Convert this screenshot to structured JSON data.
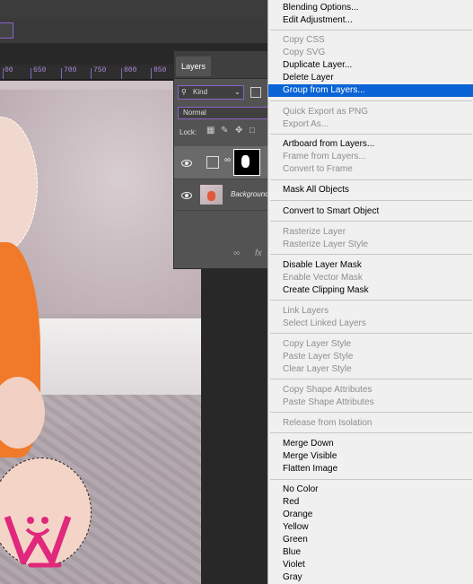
{
  "ruler": {
    "ticks": [
      "00",
      "650",
      "700",
      "750",
      "800",
      "850"
    ]
  },
  "layers_panel": {
    "tab_label": "Layers",
    "filter_kind": "Kind",
    "blend_mode": "Normal",
    "lock_label": "Lock:",
    "background_layer_name": "Background",
    "fx_label": "fx"
  },
  "context_menu": {
    "items": [
      {
        "label": "Blending Options...",
        "enabled": true
      },
      {
        "label": "Edit Adjustment...",
        "enabled": true
      },
      {
        "label": "Copy CSS",
        "enabled": false
      },
      {
        "label": "Copy SVG",
        "enabled": false
      },
      {
        "label": "Duplicate Layer...",
        "enabled": true
      },
      {
        "label": "Delete Layer",
        "enabled": true
      },
      {
        "label": "Group from Layers...",
        "enabled": true,
        "selected": true
      },
      {
        "label": "Quick Export as PNG",
        "enabled": false
      },
      {
        "label": "Export As...",
        "enabled": false
      },
      {
        "label": "Artboard from Layers...",
        "enabled": true
      },
      {
        "label": "Frame from Layers...",
        "enabled": false
      },
      {
        "label": "Convert to Frame",
        "enabled": false
      },
      {
        "label": "Mask All Objects",
        "enabled": true
      },
      {
        "label": "Convert to Smart Object",
        "enabled": true
      },
      {
        "label": "Rasterize Layer",
        "enabled": false
      },
      {
        "label": "Rasterize Layer Style",
        "enabled": false
      },
      {
        "label": "Disable Layer Mask",
        "enabled": true
      },
      {
        "label": "Enable Vector Mask",
        "enabled": false
      },
      {
        "label": "Create Clipping Mask",
        "enabled": true
      },
      {
        "label": "Link Layers",
        "enabled": false
      },
      {
        "label": "Select Linked Layers",
        "enabled": false
      },
      {
        "label": "Copy Layer Style",
        "enabled": false
      },
      {
        "label": "Paste Layer Style",
        "enabled": false
      },
      {
        "label": "Clear Layer Style",
        "enabled": false
      },
      {
        "label": "Copy Shape Attributes",
        "enabled": false
      },
      {
        "label": "Paste Shape Attributes",
        "enabled": false
      },
      {
        "label": "Release from Isolation",
        "enabled": false
      },
      {
        "label": "Merge Down",
        "enabled": true
      },
      {
        "label": "Merge Visible",
        "enabled": true
      },
      {
        "label": "Flatten Image",
        "enabled": true
      },
      {
        "label": "No Color",
        "enabled": true
      },
      {
        "label": "Red",
        "enabled": true
      },
      {
        "label": "Orange",
        "enabled": true
      },
      {
        "label": "Yellow",
        "enabled": true
      },
      {
        "label": "Green",
        "enabled": true
      },
      {
        "label": "Blue",
        "enabled": true
      },
      {
        "label": "Violet",
        "enabled": true
      },
      {
        "label": "Gray",
        "enabled": true
      }
    ]
  },
  "colors": {
    "selection": "#0a64d6",
    "accent": "#8a63c9",
    "logo": "#e0287c"
  }
}
